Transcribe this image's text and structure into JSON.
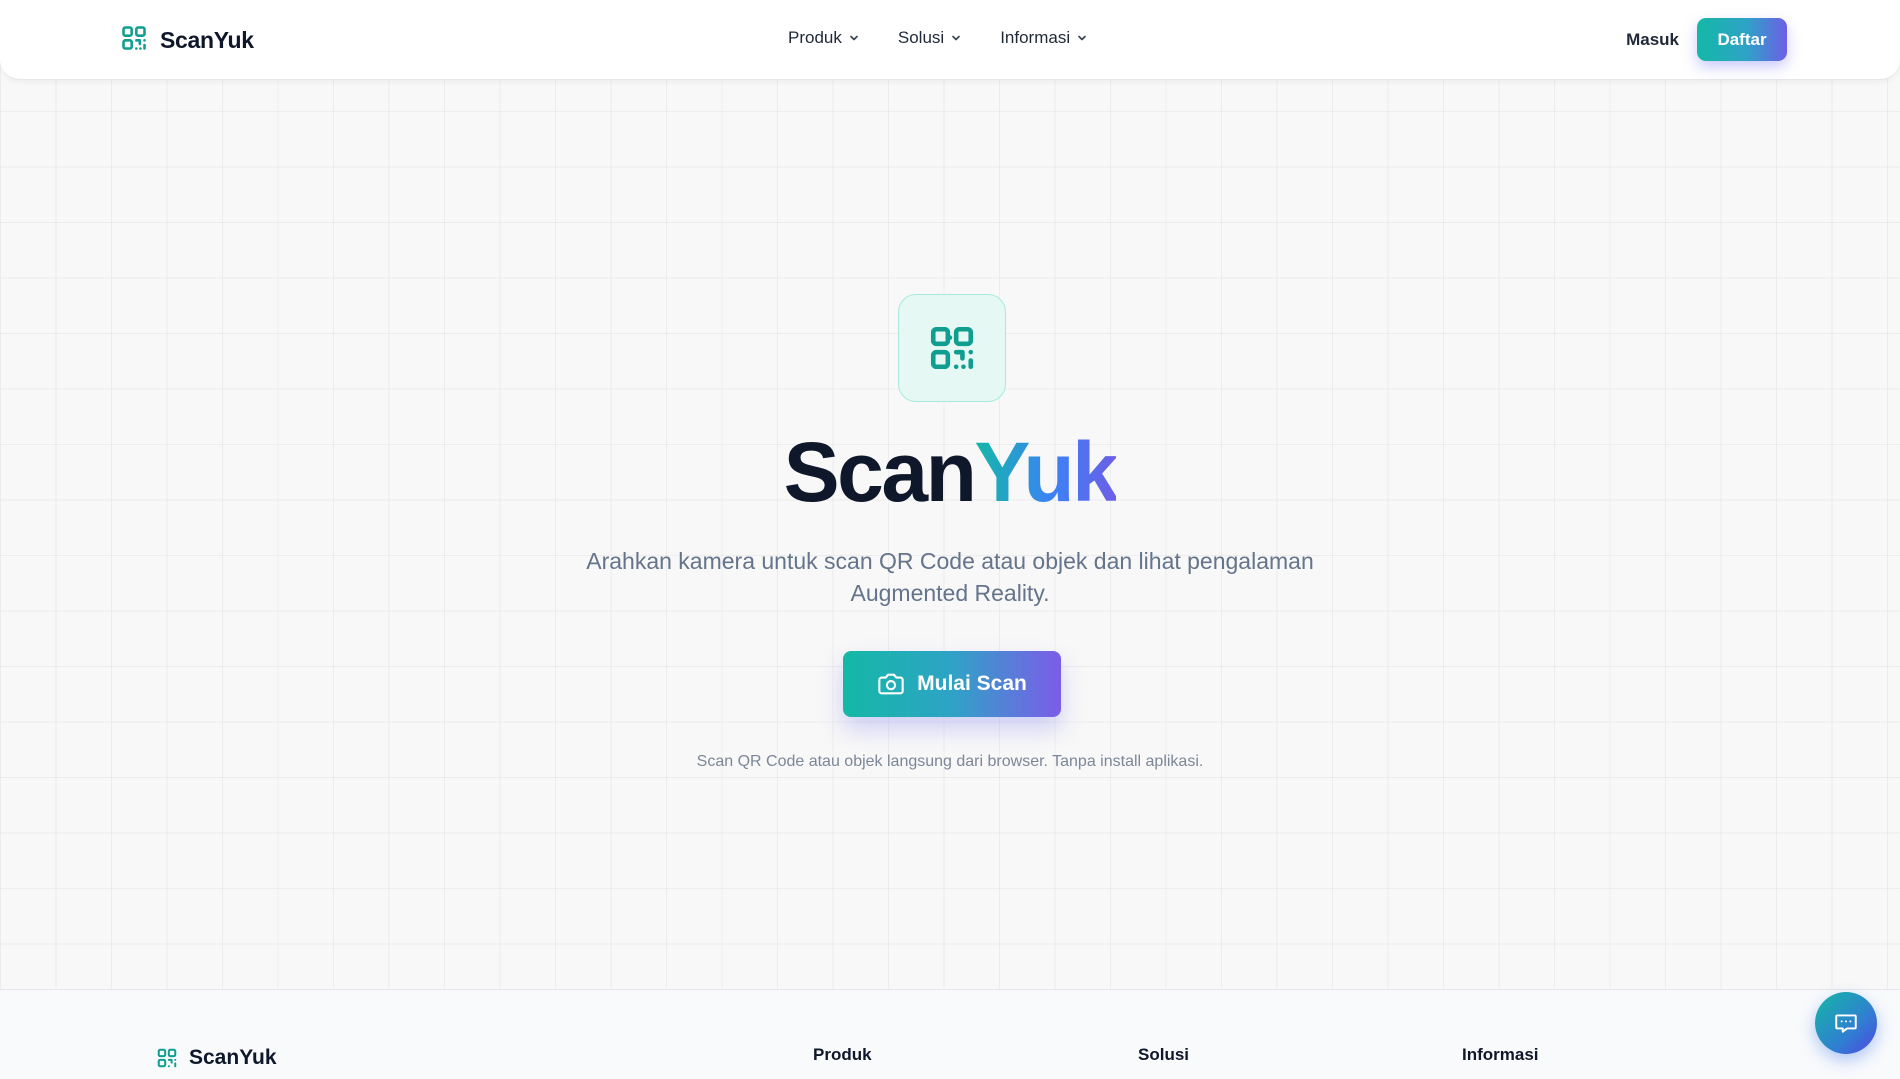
{
  "brand": {
    "name": "ScanYuk",
    "icon": "qr-code-icon",
    "accent_color": "#14b8a6"
  },
  "nav": {
    "items": [
      {
        "label": "Produk",
        "icon": "chevron-down-icon"
      },
      {
        "label": "Solusi",
        "icon": "chevron-down-icon"
      },
      {
        "label": "Informasi",
        "icon": "chevron-down-icon"
      }
    ]
  },
  "auth": {
    "login_label": "Masuk",
    "signup_label": "Daftar"
  },
  "hero": {
    "icon": "qr-code-icon",
    "title_part1": "Scan",
    "title_part2": "Yuk",
    "subtitle": "Arahkan kamera untuk scan QR Code atau objek dan lihat pengalaman Augmented Reality.",
    "cta_label": "Mulai Scan",
    "cta_icon": "camera-icon",
    "note": "Scan QR Code atau objek langsung dari browser. Tanpa install aplikasi."
  },
  "footer": {
    "brand_name": "ScanYuk",
    "headings": [
      "Produk",
      "Solusi",
      "Informasi"
    ]
  },
  "chat": {
    "icon": "chat-icon"
  },
  "colors": {
    "gradient_start": "#14b8a6",
    "gradient_end": "#7c5ce8",
    "title_dark": "#0f172a",
    "muted_text": "#64748b"
  }
}
